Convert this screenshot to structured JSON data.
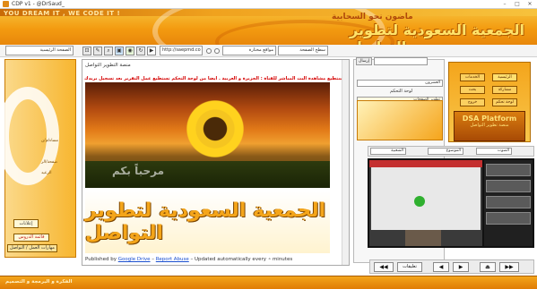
{
  "window": {
    "title": "CDP v1 - @DrSaud_",
    "min": "–",
    "max": "□",
    "close": "✕"
  },
  "banner": {
    "slogan": "YOU DREAM IT , WE CODE IT !",
    "tagline": "ماضون نحو السحابية",
    "logo_name": "الجمعية السعودية لتطوير التواصل"
  },
  "toolbar": {
    "search_placeholder": "الصفحة الرئيسية",
    "url_value": "http://saepmd.co",
    "sites_select": "مواقع مختارة",
    "zoom_select": "سطح الصفحة",
    "radio_a": "",
    "radio_b": ""
  },
  "left": {
    "lines": [
      "مساء/م/ن",
      "",
      "صفحة/الر",
      "الرعيد"
    ],
    "button1": "إعلانات",
    "button2": "قائمة الدروس",
    "button3": "مهارات العمل / التواصل"
  },
  "center": {
    "subtitle": "منصة التطوير التواصل",
    "notice": "الآن تستطيع مشاهدة البث المباشر للقناة : الجزيرة و العربية . أيضاً من لوحة التحكم تستطيع عمل التقرير بعد تسجيل بريدك",
    "welcome": "مرحباً بكم",
    "logo_text": "الجمعية السعودية لتطوير التواصل",
    "footer_published": "Published by",
    "footer_drive": "Google Drive",
    "footer_report": "Report Abuse",
    "footer_updated": "Updated automatically every",
    "footer_minutes": "minutes"
  },
  "right": {
    "select1": "العشرون",
    "label_control": "لوحة التحكم",
    "select2": "تطوير الصفحات",
    "top_input": "",
    "top_btn": "إرسال"
  },
  "navgrid": {
    "buttons": [
      "الرئيسية",
      "الخدمات",
      "مشاركة",
      "بحث",
      "لوحة تحكم",
      "خروج"
    ]
  },
  "dsa": {
    "title": "DSA Platform",
    "subtitle": "منصة تطوير التواصل"
  },
  "videobar": {
    "sel1": "الصوت",
    "sel2": "الموضوع",
    "sel3": "الشعبية"
  },
  "video": {
    "label": "فيديو",
    "thumbs": 4
  },
  "bottomnav": {
    "first": "◀◀",
    "prev": "◀",
    "next": "▶",
    "last": "▶▶",
    "extra": "تعليقات",
    "home": "⏏"
  },
  "status": {
    "text": "الفكرة و البرمجة و التصميم"
  }
}
